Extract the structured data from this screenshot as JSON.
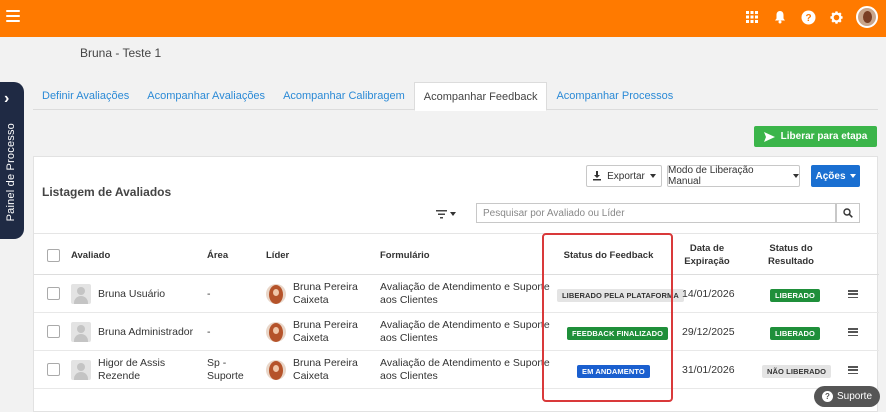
{
  "topbar": {
    "icons": [
      "apps-grid-icon",
      "bell-icon",
      "help-icon",
      "gear-icon",
      "user-avatar"
    ],
    "accent_color": "#ff7a00"
  },
  "side_panel": {
    "label": "Painel de Processo"
  },
  "page": {
    "title": "Bruna - Teste 1"
  },
  "tabs": [
    {
      "label": "Definir Avaliações",
      "active": false
    },
    {
      "label": "Acompanhar Avaliações",
      "active": false
    },
    {
      "label": "Acompanhar Calibragem",
      "active": false
    },
    {
      "label": "Acompanhar Feedback",
      "active": true
    },
    {
      "label": "Acompanhar Processos",
      "active": false
    }
  ],
  "actions": {
    "liberar": "Liberar para etapa",
    "exportar": "Exportar",
    "modo": "Modo de Liberação Manual",
    "acoes": "Ações"
  },
  "list": {
    "title": "Listagem de Avaliados",
    "search_placeholder": "Pesquisar por Avaliado ou Líder"
  },
  "table": {
    "headers": {
      "avaliado": "Avaliado",
      "area": "Área",
      "lider": "Líder",
      "formulario": "Formulário",
      "status_feedback": "Status do Feedback",
      "data_exp_1": "Data de",
      "data_exp_2": "Expiração",
      "status_res_1": "Status do",
      "status_res_2": "Resultado"
    },
    "rows": [
      {
        "avaliado_1": "Bruna Usuário",
        "avaliado_2": "",
        "area_1": "-",
        "area_2": "",
        "lider_1": "Bruna Pereira",
        "lider_2": "Caixeta",
        "form_1": "Avaliação de Atendimento e Suporte",
        "form_2": "aos Clientes",
        "status_feedback": "LIBERADO PELA PLATAFORMA",
        "status_feedback_color": "grey",
        "data": "14/01/2026",
        "status_resultado": "LIBERADO",
        "status_resultado_color": "green"
      },
      {
        "avaliado_1": "Bruna Administrador",
        "avaliado_2": "",
        "area_1": "-",
        "area_2": "",
        "lider_1": "Bruna Pereira",
        "lider_2": "Caixeta",
        "form_1": "Avaliação de Atendimento e Suporte",
        "form_2": "aos Clientes",
        "status_feedback": "FEEDBACK FINALIZADO",
        "status_feedback_color": "green",
        "data": "29/12/2025",
        "status_resultado": "LIBERADO",
        "status_resultado_color": "green"
      },
      {
        "avaliado_1": "Higor de Assis",
        "avaliado_2": "Rezende",
        "area_1": "Sp -",
        "area_2": "Suporte",
        "lider_1": "Bruna Pereira",
        "lider_2": "Caixeta",
        "form_1": "Avaliação de Atendimento e Suporte",
        "form_2": "aos Clientes",
        "status_feedback": "EM ANDAMENTO",
        "status_feedback_color": "blue",
        "data": "31/01/2026",
        "status_resultado": "NÃO LIBERADO",
        "status_resultado_color": "grey"
      }
    ]
  },
  "support": {
    "label": "Suporte"
  }
}
